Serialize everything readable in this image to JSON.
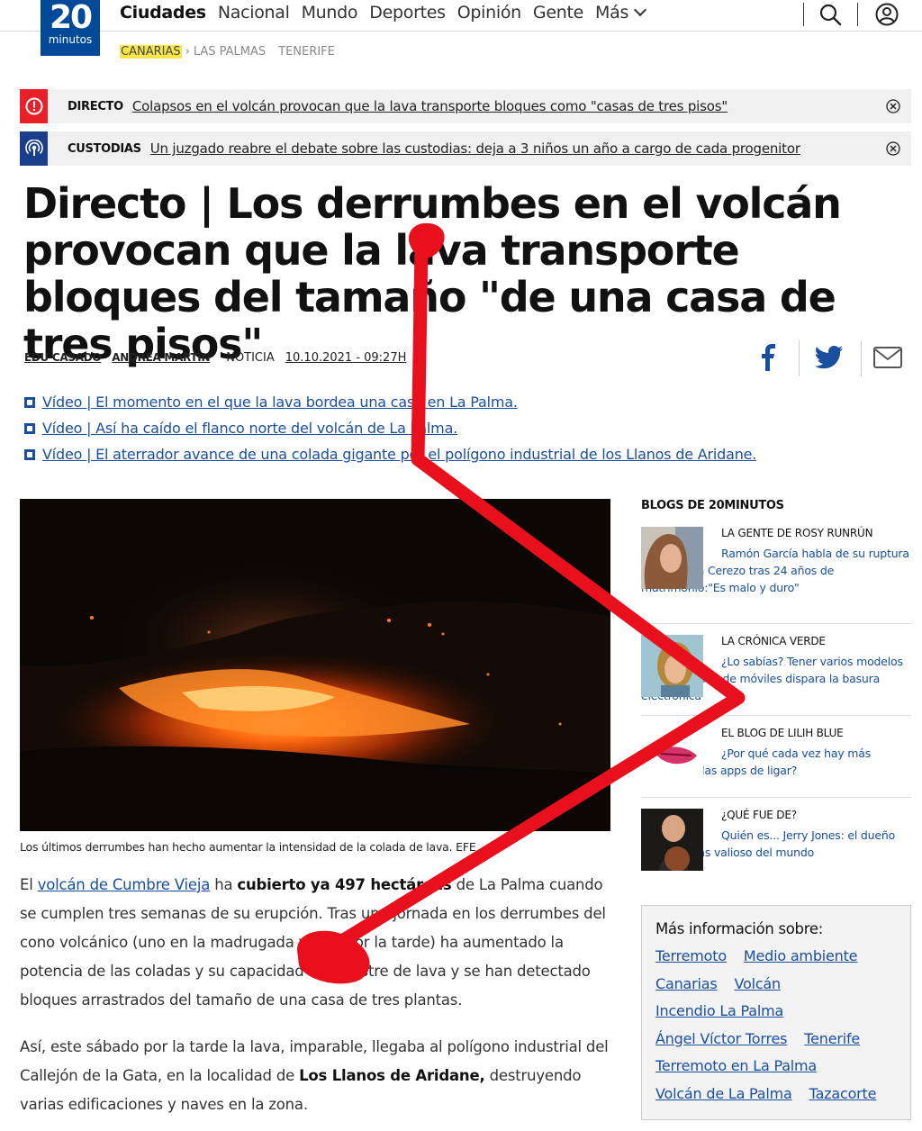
{
  "header": {
    "logo_number": "20",
    "logo_text": "minutos",
    "nav": [
      "Ciudades",
      "Nacional",
      "Mundo",
      "Deportes",
      "Opinión",
      "Gente",
      "Más"
    ]
  },
  "subnav": {
    "current": "CANARIAS",
    "items": [
      "LAS PALMAS",
      "TENERIFE"
    ]
  },
  "alerts": [
    {
      "tag": "DIRECTO",
      "message": "Colapsos en el volcán provocan que la lava transporte bloques como \"casas de tres pisos\"",
      "color": "#e8202a"
    },
    {
      "tag": "CUSTODIAS",
      "message": "Un juzgado reabre el debate sobre las custodias: deja a 3 niños un año a cargo de cada progenitor",
      "color": "#1a3f8a"
    }
  ],
  "article": {
    "title": "Directo | Los derrumbes en el volcán provocan que la lava transporte bloques del tamaño \"de una casa de tres pisos\"",
    "authors": [
      "EDU CASADO",
      "ANDREA MARTIN"
    ],
    "kind": "NOTICIA",
    "date": "10.10.2021 - 09:27H",
    "related": [
      "Vídeo | El momento en el que la lava bordea una casa en La Palma.",
      "Vídeo | Así ha caído el flanco norte del volcán de La Palma.",
      "Vídeo | El aterrador avance de una colada gigante por el polígono industrial de los Llanos de Aridane."
    ],
    "caption": "Los últimos derrumbes han hecho aumentar la intensidad de la colada de lava. EFE",
    "p1": {
      "pre": "El ",
      "link": "volcán de Cumbre Vieja",
      "mid": " ha ",
      "bold": "cubierto ya 497 hectáreas",
      "post": " de La Palma cuando se cumplen tres semanas de su erupción. Tras una jornada en los derrumbes del cono volcánico (uno en la madrugada y otro por la tarde) ha aumentado la potencia de las coladas y su capacidad de arrastre de lava y se han detectado bloques arrastrados del tamaño de una casa de tres plantas."
    },
    "p2": {
      "pre": "Así, este sábado por la tarde la lava, imparable, llegaba al polígono industrial del Callejón de la Gata, en la localidad de ",
      "bold": "Los Llanos de Aridane,",
      "post": " destruyendo varias edificaciones y naves en la zona."
    }
  },
  "sidebar": {
    "title": "BLOGS DE 20MINUTOS",
    "blogs": [
      {
        "name": "LA GENTE DE ROSY RUNRÚN",
        "text": "Ramón García habla de su ruptura con Patricia Cerezo tras 24 años de matrimonio:\"Es malo y duro\""
      },
      {
        "name": "LA CRÓNICA VERDE",
        "text": "¿Lo sabías? Tener varios modelos de cargadores de móviles dispara la basura electrónica"
      },
      {
        "name": "EL BLOG DE LILIH BLUE",
        "text": "¿Por qué cada vez hay más parejas en las apps de ligar?"
      },
      {
        "name": "¿QUÉ FUE DE?",
        "text": "Quién es... Jerry Jones: el dueño del club más valioso del mundo"
      }
    ],
    "more_title": "Más información sobre:",
    "tags": [
      "Terremoto",
      "Medio ambiente",
      "Canarias",
      "Volcán",
      "Incendio La Palma",
      "Ángel Víctor Torres",
      "Tenerife",
      "Terremoto en La Palma",
      "Volcán de La Palma",
      "Tazacorte"
    ]
  },
  "colors": {
    "brand": "#004a99",
    "link": "#1a4fa0",
    "annotation": "#e8101c"
  }
}
